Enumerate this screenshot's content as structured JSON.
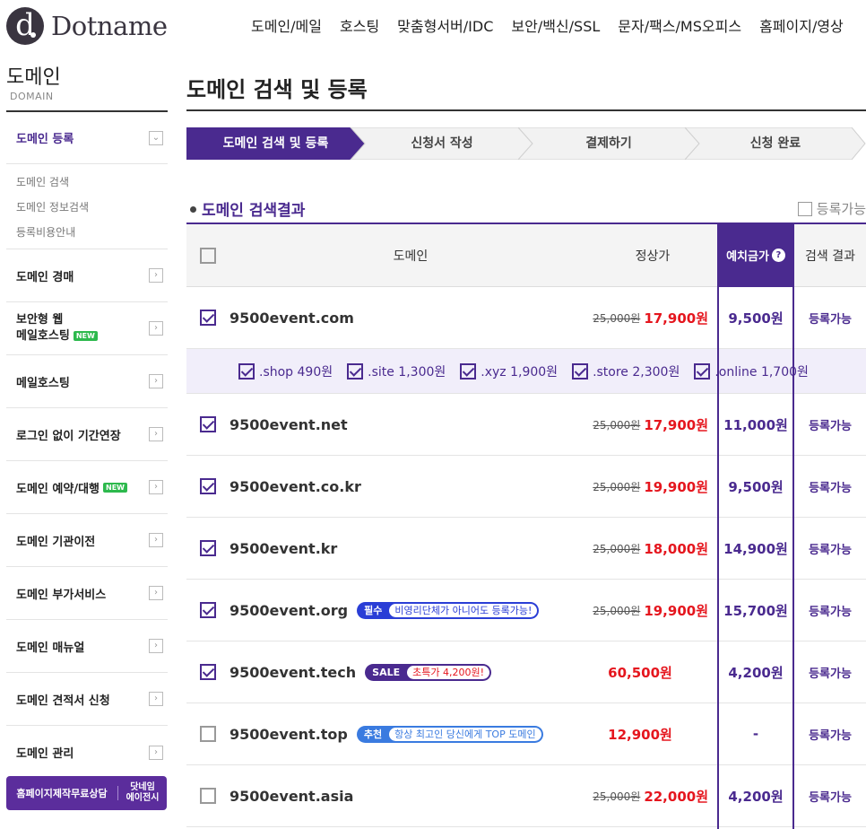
{
  "brand": {
    "logo_letter": "d.",
    "name": "Dotname"
  },
  "gnb": [
    "도메인/메일",
    "호스팅",
    "맞춤형서버/IDC",
    "보안/백신/SSL",
    "문자/팩스/MS오피스",
    "홈페이지/영상"
  ],
  "sidebar": {
    "title": "도메인",
    "subtitle": "DOMAIN",
    "active_item": "도메인 등록",
    "sub_items": [
      "도메인 검색",
      "도메인 정보검색",
      "등록비용안내"
    ],
    "items": [
      {
        "label": "도메인 경매",
        "new": ""
      },
      {
        "label": "보안형 웹",
        "label2": "메일호스팅",
        "new": "NEW"
      },
      {
        "label": "메일호스팅",
        "new": ""
      },
      {
        "label": "로그인 없이 기간연장",
        "new": ""
      },
      {
        "label": "도메인 예약/대행",
        "new": "NEW"
      },
      {
        "label": "도메인 기관이전",
        "new": ""
      },
      {
        "label": "도메인 부가서비스",
        "new": ""
      },
      {
        "label": "도메인 매뉴얼",
        "new": ""
      },
      {
        "label": "도메인 견적서 신청",
        "new": ""
      },
      {
        "label": "도메인 관리",
        "new": ""
      }
    ],
    "cta_left": "홈페이지제작무료상담",
    "cta_right_1": "닷네임",
    "cta_right_2": "에이전시"
  },
  "page_title": "도메인 검색 및 등록",
  "steps": [
    "도메인 검색 및 등록",
    "신청서 작성",
    "결제하기",
    "신청 완료"
  ],
  "section": {
    "title": "도메인 검색결과",
    "filter_label": "등록가능"
  },
  "table": {
    "headers": {
      "domain": "도메인",
      "price": "정상가",
      "deposit": "예치금가",
      "deposit_help": "?",
      "result": "검색 결과"
    },
    "rows": [
      {
        "domain": "9500event.com",
        "checked": true,
        "old": "25,000원",
        "price": "17,900원",
        "deposit": "9,500원",
        "result": "등록가능"
      },
      {
        "domain": "9500event.net",
        "checked": true,
        "old": "25,000원",
        "price": "17,900원",
        "deposit": "11,000원",
        "result": "등록가능"
      },
      {
        "domain": "9500event.co.kr",
        "checked": true,
        "old": "25,000원",
        "price": "19,900원",
        "deposit": "9,500원",
        "result": "등록가능"
      },
      {
        "domain": "9500event.kr",
        "checked": true,
        "old": "25,000원",
        "price": "18,000원",
        "deposit": "14,900원",
        "result": "등록가능"
      },
      {
        "domain": "9500event.org",
        "checked": true,
        "old": "25,000원",
        "price": "19,900원",
        "deposit": "15,700원",
        "result": "등록가능",
        "tag1": "필수",
        "tag2": "비영리단체가 아니어도 등록가능!",
        "tag_color": "#2a3ed6"
      },
      {
        "domain": "9500event.tech",
        "checked": true,
        "old": "",
        "price": "60,500원",
        "deposit": "4,200원",
        "result": "등록가능",
        "tag1": "SALE",
        "tag2": "초특가 4,200원!",
        "tag_color": "#4a2a8f"
      },
      {
        "domain": "9500event.top",
        "checked": false,
        "old": "",
        "price": "12,900원",
        "deposit": "-",
        "result": "등록가능",
        "tag1": "추천",
        "tag2": "항상 최고인 당신에게 TOP 도메인",
        "tag_color": "#3a7be0"
      },
      {
        "domain": "9500event.asia",
        "checked": false,
        "old": "25,000원",
        "price": "22,000원",
        "deposit": "4,200원",
        "result": "등록가능"
      }
    ],
    "extensions": [
      ".shop 490원",
      ".site 1,300원",
      ".xyz 1,900원",
      ".store 2,300원",
      ".online 1,700원"
    ]
  },
  "colors": {
    "accent": "#4a2a8f",
    "price_red": "#e5161e"
  }
}
